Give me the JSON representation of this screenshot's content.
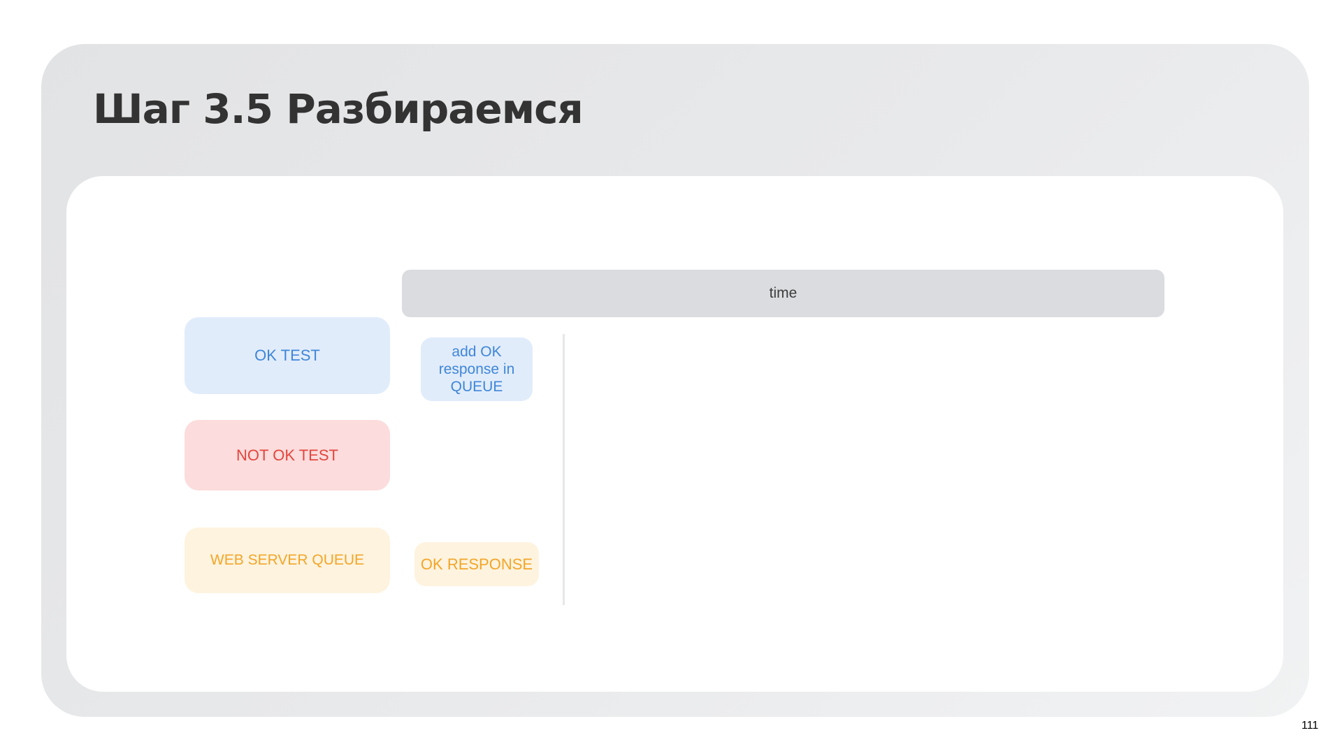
{
  "slide": {
    "title": "Шаг 3.5 Разбираемся",
    "page_number": "111"
  },
  "diagram": {
    "timeline_label": "time",
    "rows": [
      {
        "label": "OK TEST",
        "color": "#3f86d8",
        "background": "#e1ecfb"
      },
      {
        "label": "NOT OK TEST",
        "color": "#e2463e",
        "background": "#fcdcdc"
      },
      {
        "label": "WEB SERVER QUEUE",
        "color": "#f2a628",
        "background": "#fef3df"
      }
    ],
    "events": [
      {
        "row": "OK TEST",
        "label": "add OK response in QUEUE"
      },
      {
        "row": "WEB SERVER QUEUE",
        "label": "OK RESPONSE"
      }
    ]
  }
}
